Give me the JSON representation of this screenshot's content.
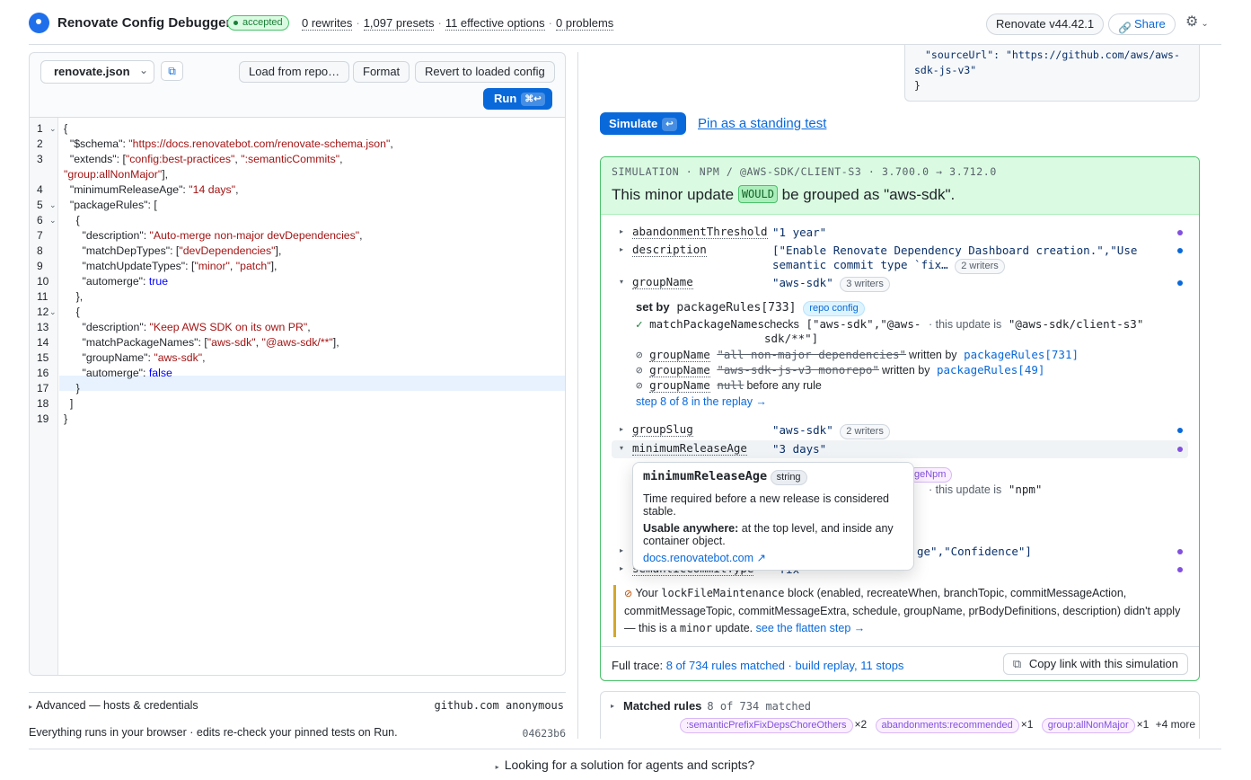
{
  "header": {
    "title": "Renovate Config Debugger",
    "status": "accepted",
    "rewrites": "0 rewrites",
    "presets": "1,097 presets",
    "effective": "11 effective options",
    "problems": "0 problems",
    "version": "Renovate v44.42.1",
    "share": "Share"
  },
  "editor": {
    "file": "renovate.json",
    "load_label": "Load from repo…",
    "format_label": "Format",
    "revert_label": "Revert to loaded config",
    "run_label": "Run",
    "run_shortcut": "⌘↩",
    "line_numbers": [
      "1",
      "2",
      "3",
      "",
      "4",
      "5",
      "6",
      "7",
      "8",
      "9",
      "10",
      "11",
      "12",
      "13",
      "14",
      "15",
      "16",
      "17",
      "18",
      "19"
    ]
  },
  "advanced": {
    "label": "Advanced — hosts & credentials",
    "host": "github.com anonymous"
  },
  "footer": {
    "note": "Everything runs in your browser · edits re-check your pinned tests on Run.",
    "hash": "04623b6"
  },
  "right": {
    "source_line1": "\"sourceUrl\": \"https://github.com/aws/aws-",
    "source_line2": "sdk-js-v3\"",
    "source_line3": "}",
    "simulate_label": "Simulate",
    "simulate_shortcut": "↩",
    "pin_label": "Pin as a standing test",
    "sim_eyebrow": "SIMULATION · NPM / @AWS-SDK/CLIENT-S3 · 3.700.0 → 3.712.0",
    "verdict_pre": "This minor update",
    "verdict_badge": "WOULD",
    "verdict_post": "be grouped as \"aws-sdk\".",
    "options": {
      "abandonment_name": "abandonmentThreshold",
      "abandonment_val": "\"1 year\"",
      "description_name": "description",
      "description_val1": "[\"Enable Renovate Dependency Dashboard creation.\",\"Use",
      "description_val2": "semantic commit type `fix…",
      "description_writers": "2 writers",
      "groupname_name": "groupName",
      "groupname_val": "\"aws-sdk\"",
      "groupname_writers": "3 writers",
      "groupslug_name": "groupSlug",
      "groupslug_val": "\"aws-sdk\"",
      "groupslug_writers": "2 writers",
      "minage_name": "minimumReleaseAge",
      "minage_val": "\"3 days\"",
      "labels_val": "ge\",\"Confidence\"]",
      "semantic_name": "semanticCommitType",
      "semantic_val": "\"fix\""
    },
    "group_detail": {
      "set_by": "set by",
      "set_by_rule": "packageRules[733]",
      "set_by_tag": "repo config",
      "check_name": "matchPackageNames",
      "check_checks": "checks",
      "check_value": "[\"aws-sdk\",\"@aws-",
      "check_value2": "sdk/**\"]",
      "check_result": "· this update is",
      "check_result_val": "\"@aws-sdk/client-s3\"",
      "row1_name": "groupName",
      "row1_val": "\"all non-major dependencies\"",
      "row1_by": "written by",
      "row1_rule": "packageRules[731]",
      "row2_name": "groupName",
      "row2_val": "\"aws-sdk-js-v3 monorepo\"",
      "row2_by": "written by",
      "row2_rule": "packageRules[49]",
      "row3_name": "groupName",
      "row3_val": "null",
      "row3_by": "before any rule",
      "step": "step 8 of 8 in the replay →"
    },
    "minage_detail": {
      "tag_partial": "geNpm",
      "result": "· this update is",
      "result_val": "\"npm\""
    },
    "lockfile": {
      "p1": "Your",
      "m1": "lockFileMaintenance",
      "p2": "block (enabled, recreateWhen, branchTopic, commitMessageAction, commitMessageTopic, commitMessageExtra, schedule, groupName, prBodyDefinitions, description) didn't apply — this is a",
      "m2": "minor",
      "p3": "update.",
      "link": "see the flatten step →"
    },
    "full_trace_label": "Full trace:",
    "full_trace_link": "8 of 734 rules matched · build replay, 11 stops",
    "copy_link": "Copy link with this simulation",
    "matched_title": "Matched rules",
    "matched_count": "8 of 734 matched",
    "matched_tags": [
      {
        "label": ":semanticPrefixFixDepsChoreOthers",
        "count": "×2"
      },
      {
        "label": "abandonments:recommended",
        "count": "×1"
      },
      {
        "label": "group:allNonMajor",
        "count": "×1"
      }
    ],
    "matched_more": "+4 more"
  },
  "tooltip": {
    "name": "minimumReleaseAge",
    "type": "string",
    "desc": "Time required before a new release is considered stable.",
    "usable_label": "Usable anywhere:",
    "usable_text": "at the top level, and inside any container object.",
    "link": "docs.renovatebot.com ↗"
  },
  "bottom": {
    "label": "Looking for a solution for agents and scripts?"
  },
  "icons": [
    "logo-icon",
    "copy-icon",
    "link-icon",
    "gear-icon",
    "chevron-down-icon",
    "check-icon",
    "blocked-icon"
  ],
  "colors": {
    "accent": "#0969da",
    "success": "#1a7f37",
    "string": "#a31515",
    "keyword": "#0000ff",
    "writer_dot_blue": "#0969da",
    "writer_dot_purple": "#8250df"
  }
}
